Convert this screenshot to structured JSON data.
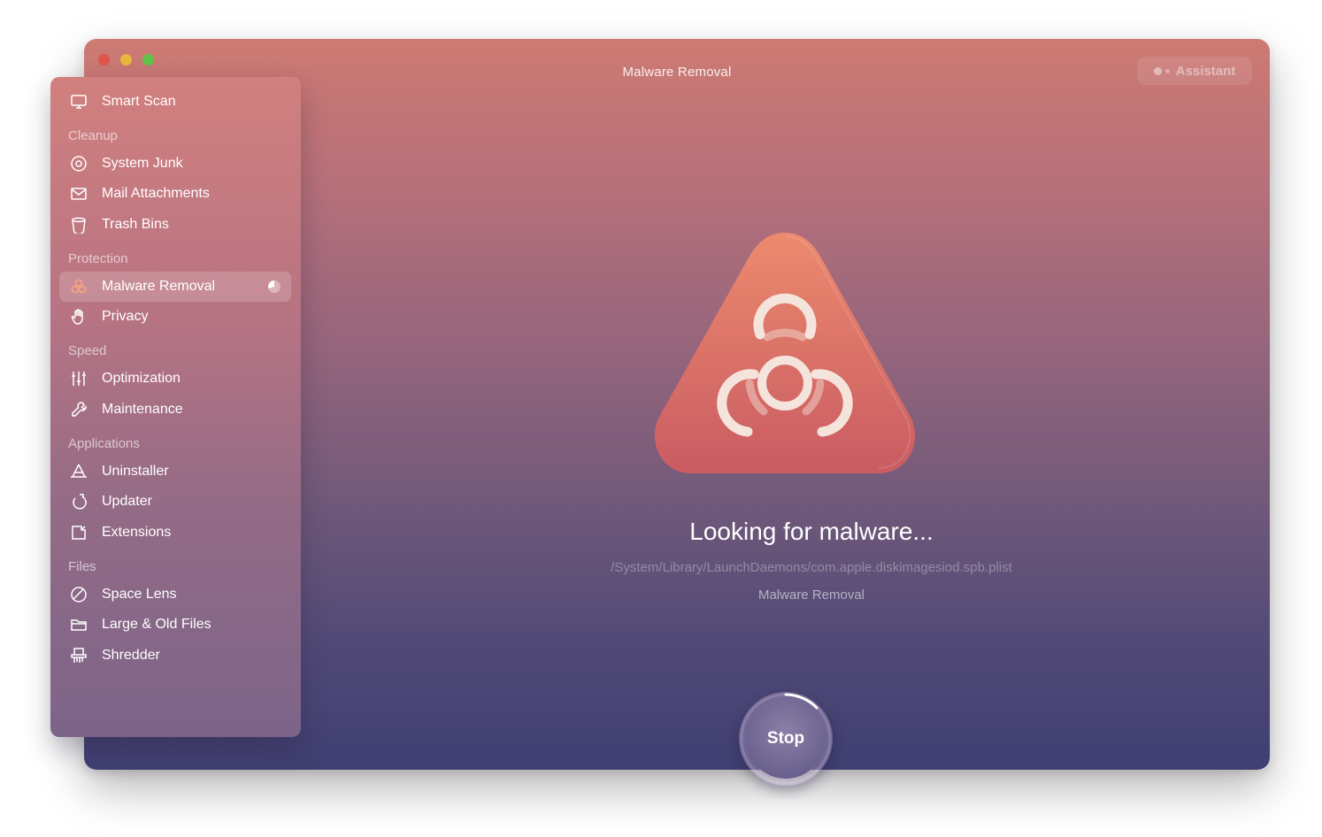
{
  "window": {
    "title": "Malware Removal",
    "assistant_label": "Assistant"
  },
  "sidebar": {
    "top_item": {
      "label": "Smart Scan",
      "icon": "monitor-icon"
    },
    "sections": [
      {
        "title": "Cleanup",
        "items": [
          {
            "label": "System Junk",
            "icon": "disc-icon"
          },
          {
            "label": "Mail Attachments",
            "icon": "envelope-icon"
          },
          {
            "label": "Trash Bins",
            "icon": "trash-icon"
          }
        ]
      },
      {
        "title": "Protection",
        "items": [
          {
            "label": "Malware Removal",
            "icon": "biohazard-icon",
            "active": true
          },
          {
            "label": "Privacy",
            "icon": "hand-icon"
          }
        ]
      },
      {
        "title": "Speed",
        "items": [
          {
            "label": "Optimization",
            "icon": "sliders-icon"
          },
          {
            "label": "Maintenance",
            "icon": "wrench-icon"
          }
        ]
      },
      {
        "title": "Applications",
        "items": [
          {
            "label": "Uninstaller",
            "icon": "apps-icon"
          },
          {
            "label": "Updater",
            "icon": "update-arrow-icon"
          },
          {
            "label": "Extensions",
            "icon": "extensions-icon"
          }
        ]
      },
      {
        "title": "Files",
        "items": [
          {
            "label": "Space Lens",
            "icon": "lens-icon"
          },
          {
            "label": "Large & Old Files",
            "icon": "folder-icon"
          },
          {
            "label": "Shredder",
            "icon": "shredder-icon"
          }
        ]
      }
    ]
  },
  "main": {
    "hero_icon": "biohazard-triangle-icon",
    "status": "Looking for malware...",
    "current_path": "/System/Library/LaunchDaemons/com.apple.diskimagesiod.spb.plist",
    "module_name": "Malware Removal",
    "stop_label": "Stop"
  },
  "colors": {
    "gradient_top": "#cd7a72",
    "gradient_bottom": "#3f3f72",
    "hero_triangle": "#e07a6a"
  }
}
